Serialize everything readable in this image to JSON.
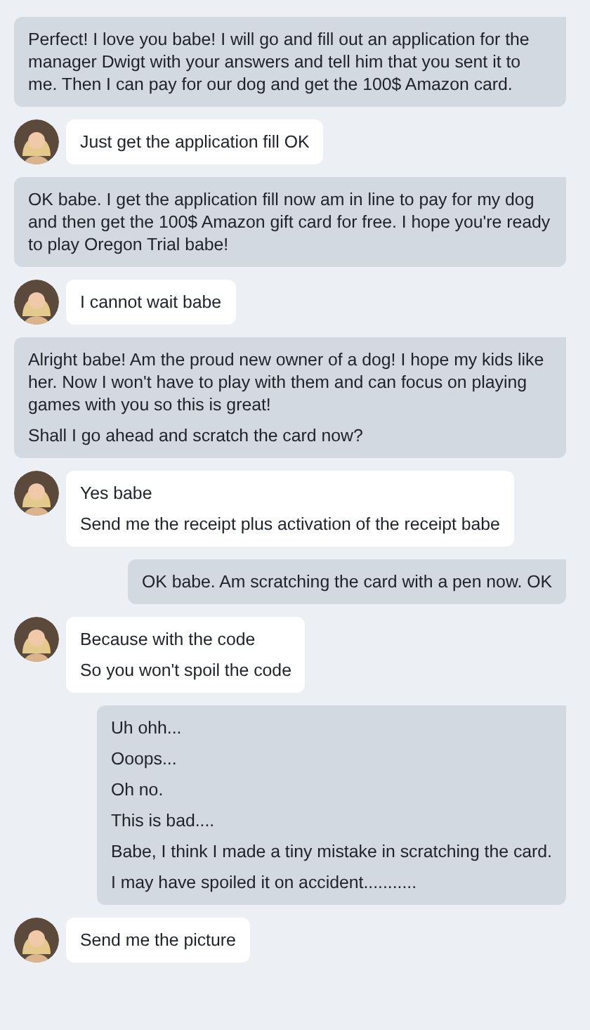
{
  "messages": [
    {
      "kind": "sent",
      "lines": [
        "Perfect! I love you babe! I will go and fill out an application for the manager Dwigt with your answers and tell him that you sent it to me. Then I can pay for our dog and get the 100$ Amazon card."
      ]
    },
    {
      "kind": "received",
      "lines": [
        "Just get the application fill OK"
      ]
    },
    {
      "kind": "sent",
      "lines": [
        "OK babe. I get the application fill now am in line to pay for my dog and then get the 100$ Amazon gift card for free. I hope you're ready to play Oregon Trial babe!"
      ]
    },
    {
      "kind": "received",
      "lines": [
        "I cannot wait babe"
      ]
    },
    {
      "kind": "sent",
      "lines": [
        "Alright babe! Am the proud new owner of a dog! I hope my kids like her. Now I won't have to play with them and can focus on playing games with you so this is great!",
        "Shall I go ahead and scratch the card now?"
      ]
    },
    {
      "kind": "received",
      "lines": [
        "Yes babe",
        "Send me the receipt plus activation of the receipt babe"
      ]
    },
    {
      "kind": "sent",
      "lines": [
        "OK babe. Am scratching the card with a pen now. OK"
      ]
    },
    {
      "kind": "received",
      "lines": [
        "Because with the code",
        "So you won't spoil the code"
      ]
    },
    {
      "kind": "sent",
      "lines": [
        "Uh ohh...",
        "Ooops...",
        "Oh no.",
        "This is bad....",
        "Babe, I think I made a tiny mistake in scratching the card.",
        "I may have spoiled it on accident..........."
      ]
    },
    {
      "kind": "received",
      "lines": [
        "Send me the picture"
      ]
    }
  ]
}
